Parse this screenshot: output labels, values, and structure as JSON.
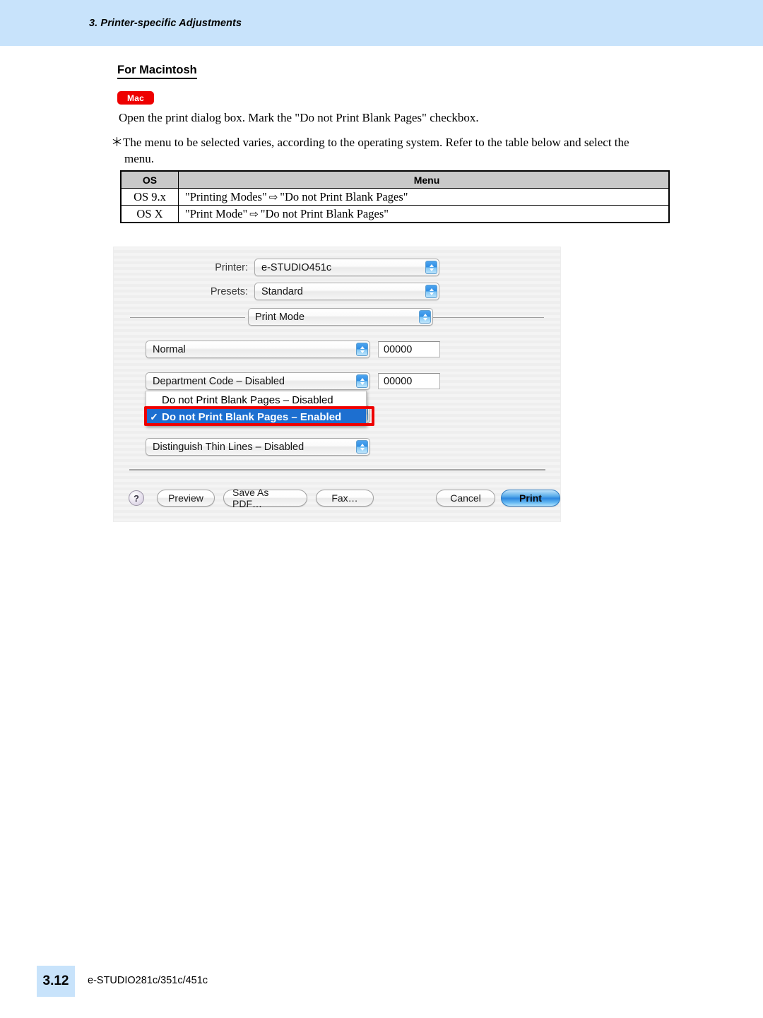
{
  "header": {
    "chapter_title": "3. Printer-specific Adjustments",
    "band_color": "#c8e3fb"
  },
  "section": {
    "heading": "For Macintosh",
    "platform_badge": "Mac",
    "badge_color": "#ee0000"
  },
  "body": {
    "instruction": "Open the print dialog box.  Mark the \"Do not Print Blank Pages\" checkbox.",
    "note_line1": "＊The menu to be selected varies, according to the operating system. Refer to the table below and select the",
    "note_line2": "menu."
  },
  "os_table": {
    "headers": [
      "OS",
      "Menu"
    ],
    "rows": [
      {
        "os": "OS 9.x",
        "menu_from": "\"Printing Modes\"",
        "arrow": "⇨",
        "menu_to": "\"Do not Print Blank Pages\""
      },
      {
        "os": "OS X",
        "menu_from": "\"Print Mode\"",
        "arrow": "⇨",
        "menu_to": "\"Do not Print Blank Pages\""
      }
    ]
  },
  "print_dialog": {
    "printer_label": "Printer:",
    "printer_value": "e-STUDIO451c",
    "presets_label": "Presets:",
    "presets_value": "Standard",
    "pane_value": "Print Mode",
    "quality_value": "Normal",
    "quality_field": "00000",
    "department_value": "Department Code – Disabled",
    "department_field": "00000",
    "thin_lines_value": "Distinguish Thin Lines – Disabled",
    "open_menu": {
      "items": [
        {
          "label": "Do not Print Blank Pages – Disabled",
          "checked": false,
          "selected": false
        },
        {
          "label": "Do not Print Blank Pages – Enabled",
          "checked": true,
          "selected": true
        }
      ],
      "checkmark": "✓",
      "highlight_color": "#1d6fd0",
      "annotation_color": "#ee0000"
    },
    "buttons": {
      "help": "?",
      "preview": "Preview",
      "save_as_pdf": "Save As PDF…",
      "fax": "Fax…",
      "cancel": "Cancel",
      "print": "Print"
    }
  },
  "footer": {
    "page_number": "3.12",
    "model": "e-STUDIO281c/351c/451c"
  }
}
